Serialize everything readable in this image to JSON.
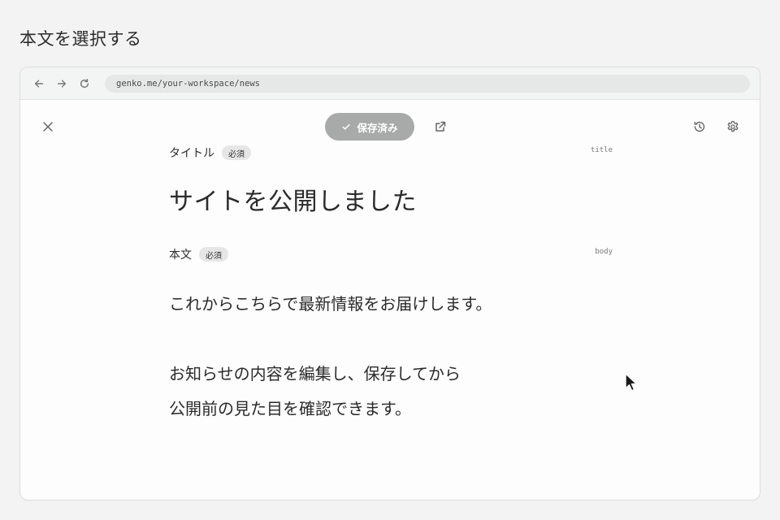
{
  "heading": "本文を選択する",
  "browser": {
    "url": "genko.me/your-workspace/news"
  },
  "toolbar": {
    "saved_label": "保存済み"
  },
  "icons": {
    "back": "arrow-left-icon",
    "forward": "arrow-right-icon",
    "reload": "reload-icon",
    "close": "close-icon",
    "saved": "check-icon",
    "open_external": "external-link-icon",
    "history": "history-icon",
    "settings": "gear-icon",
    "cursor": "mouse-pointer-icon"
  },
  "fields": {
    "title": {
      "label": "タイトル",
      "required": "必須",
      "key": "title",
      "value": "サイトを公開しました"
    },
    "body": {
      "label": "本文",
      "required": "必須",
      "key": "body",
      "lines": [
        "これからこちらで最新情報をお届けします。",
        "",
        "お知らせの内容を編集し、保存してから",
        "公開前の見た目を確認できます。"
      ]
    }
  },
  "colors": {
    "saved_button": "#a8aaa9",
    "url_bar": "#e5e8e7",
    "badge": "#e6e6e6"
  }
}
